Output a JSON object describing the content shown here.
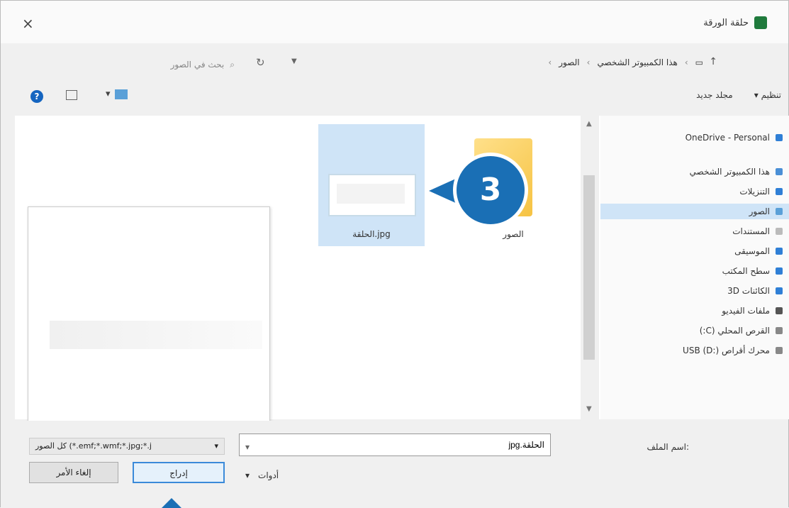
{
  "window": {
    "title": "حلقة الورقة",
    "close": "×"
  },
  "address": {
    "breadcrumb": [
      "هذا الكمبيوتر الشخصي",
      "الصور"
    ],
    "search_placeholder": "بحث في الصور"
  },
  "toolbar": {
    "organize": "تنظيم",
    "new_folder": "مجلد جديد"
  },
  "files": [
    {
      "label": "الصور",
      "type": "folder"
    },
    {
      "label": "الحلقة.jpg",
      "type": "image",
      "selected": true
    }
  ],
  "callout": {
    "number": "3"
  },
  "nav": [
    {
      "label": "OneDrive - Personal",
      "icon": "cloud-icon",
      "color": "#2f7fd6"
    },
    {
      "label": "هذا الكمبيوتر الشخصي",
      "icon": "computer-icon",
      "color": "#4a8fd6"
    },
    {
      "label": "التنزيلات",
      "icon": "download-icon",
      "color": "#2f7fd6"
    },
    {
      "label": "الصور",
      "icon": "pictures-icon",
      "color": "#5aa0d8",
      "active": true
    },
    {
      "label": "المستندات",
      "icon": "documents-icon",
      "color": "#bbbbbb"
    },
    {
      "label": "الموسيقى",
      "icon": "music-icon",
      "color": "#2f7fd6"
    },
    {
      "label": "سطح المكتب",
      "icon": "desktop-icon",
      "color": "#2f7fd6"
    },
    {
      "label": "الكائنات 3D",
      "icon": "objects-3d-icon",
      "color": "#2f7fd6"
    },
    {
      "label": "ملفات الفيديو",
      "icon": "video-icon",
      "color": "#555555"
    },
    {
      "label": "القرص المحلي (C:)",
      "icon": "drive-icon",
      "color": "#888888"
    },
    {
      "label": "محرك أقراص USB (D:)",
      "icon": "usb-drive-icon",
      "color": "#888888"
    }
  ],
  "bottom": {
    "filename_label": "اسم الملف:",
    "filename_value": "الحلقة.jpg",
    "filetype_value": "كل الصور (*.emf;*.wmf;*.jpg;*.j",
    "tools_label": "أدوات",
    "insert_label": "إدراج",
    "cancel_label": "إلغاء الأمر"
  }
}
